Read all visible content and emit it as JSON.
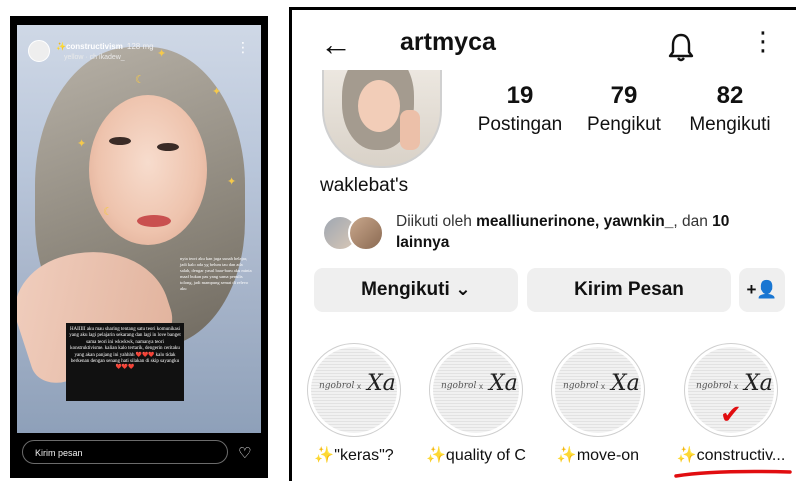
{
  "story": {
    "highlight_title": "✨constructivism",
    "time": "128 mg",
    "music": "yellow · ch ikadew_",
    "caption_right": "nyta teori aku kan juga sunah belajar, jadi kalo ada yg belum tau dan ada salah, dengar yasul baar-baru aku minta maaf bukan pas yang sama penulis tolong, jadi mampung semai di relevo aku",
    "textbox": "HAIIIII aku mau sharing tentang satu teori komunikasi yang aku lagi pelajarin sekarang dan lagi in love banget sama teori ini wkwkwk, namanya teori konstruktivisme. kalian kalo tertarik, dengerin ceritaku yang akan panjang ini yahhhh ❤️❤️❤️ kalo tidak berkenan dengan senang hati silakan di skip sayangku❤️❤️❤️",
    "reply_placeholder": "Kirim pesan"
  },
  "profile": {
    "username": "artmyca",
    "display_name": "waklebat's",
    "stats": [
      {
        "value": "19",
        "label": "Postingan"
      },
      {
        "value": "79",
        "label": "Pengikut"
      },
      {
        "value": "82",
        "label": "Mengikuti"
      }
    ],
    "followed_by_prefix": "Diikuti oleh ",
    "followed_by_names": "mealliunerinone, yawnkin_",
    "followed_by_mid": ", dan ",
    "followed_by_more": "10 lainnya",
    "buttons": {
      "following": "Mengikuti ⌄",
      "message": "Kirim Pesan",
      "add_user": "+👤"
    },
    "highlights": [
      {
        "label": "✨\"keras\"?",
        "brand": "ngobrol",
        "logo": "Xa"
      },
      {
        "label": "✨quality of C...",
        "brand": "ngobrol",
        "logo": "Xa"
      },
      {
        "label": "✨move-on",
        "brand": "ngobrol",
        "logo": "Xa"
      },
      {
        "label": "✨constructiv...",
        "brand": "ngobrol",
        "logo": "Xa"
      }
    ],
    "x_mark": "x"
  },
  "colors": {
    "accent_red": "#e10d10",
    "button_bg": "#efefef",
    "sparkle": "#f6c22b"
  },
  "icons": [
    "back-arrow-icon",
    "bell-icon",
    "more-vertical-icon",
    "heart-icon",
    "chevron-down-icon",
    "add-user-icon"
  ]
}
